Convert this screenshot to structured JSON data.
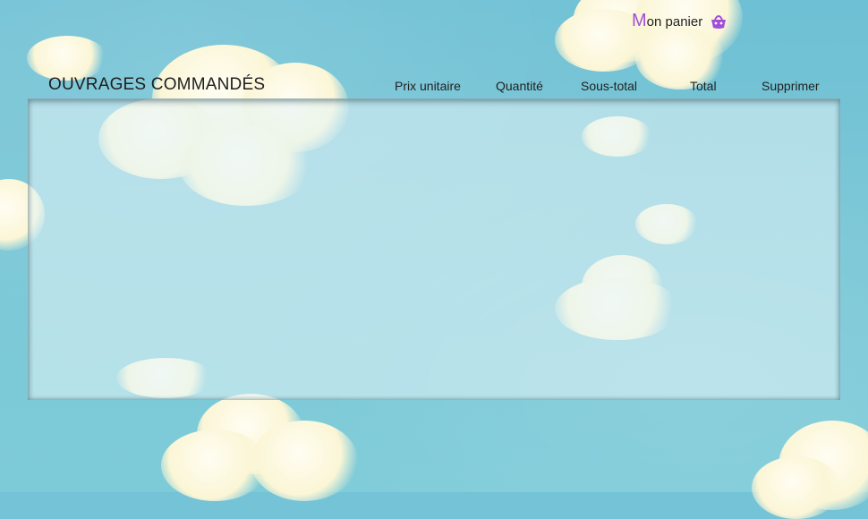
{
  "cart": {
    "initial": "M",
    "rest": "on panier",
    "icon": "basket-icon",
    "accent_color": "#a24ed8"
  },
  "orders": {
    "title": "OUVRAGES COMMANDÉS",
    "columns": [
      "Prix unitaire",
      "Quantité",
      "Sous-total",
      "Total",
      "Supprimer"
    ]
  }
}
